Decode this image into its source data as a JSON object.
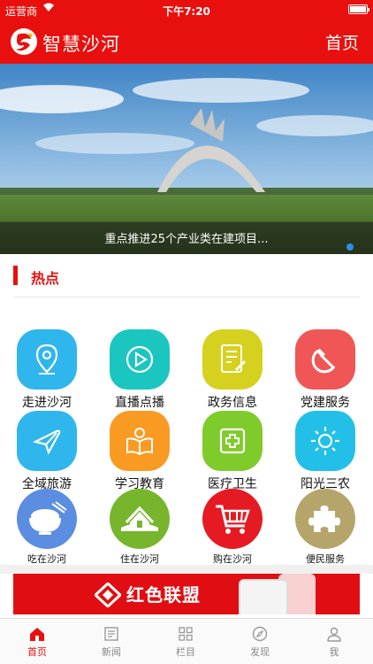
{
  "status_bar": {
    "carrier": "运营商",
    "time": "下午7:20"
  },
  "app_bar": {
    "title": "智慧沙河",
    "home_label": "首页"
  },
  "banner": {
    "caption": "重点推进25个产业类在建项目..."
  },
  "section": {
    "title": "热点"
  },
  "grid": [
    {
      "label": "走进沙河",
      "icon": "location-pin-icon",
      "color": "#2fb6ec"
    },
    {
      "label": "直播点播",
      "icon": "play-icon",
      "color": "#1cc6c0"
    },
    {
      "label": "政务信息",
      "icon": "document-edit-icon",
      "color": "#d5d11e"
    },
    {
      "label": "党建服务",
      "icon": "hammer-sickle-icon",
      "color": "#f05656"
    },
    {
      "label": "全域旅游",
      "icon": "airplane-icon",
      "color": "#2fb6ec"
    },
    {
      "label": "学习教育",
      "icon": "reading-book-icon",
      "color": "#f99a22"
    },
    {
      "label": "医疗卫生",
      "icon": "medical-cross-icon",
      "color": "#7fcb2c"
    },
    {
      "label": "阳光三农",
      "icon": "sun-icon",
      "color": "#22c0e8"
    },
    {
      "label": "吃在沙河",
      "icon": "rice-bowl-icon",
      "color": "#5b8de0"
    },
    {
      "label": "住在沙河",
      "icon": "house-icon",
      "color": "#77b52c"
    },
    {
      "label": "购在沙河",
      "icon": "shopping-cart-icon",
      "color": "#e51a22"
    },
    {
      "label": "便民服务",
      "icon": "puzzle-icon",
      "color": "#b5a56a"
    }
  ],
  "ad": {
    "title": "红色联盟"
  },
  "tabbar": [
    {
      "label": "首页",
      "icon": "home-icon",
      "active": true
    },
    {
      "label": "新闻",
      "icon": "news-icon",
      "active": false
    },
    {
      "label": "栏目",
      "icon": "grid-icon",
      "active": false
    },
    {
      "label": "发现",
      "icon": "compass-icon",
      "active": false
    },
    {
      "label": "我",
      "icon": "person-icon",
      "active": false
    }
  ],
  "colors": {
    "brand": "#e8100e",
    "tab_active": "#e8100e",
    "tab_inactive": "#888888"
  }
}
